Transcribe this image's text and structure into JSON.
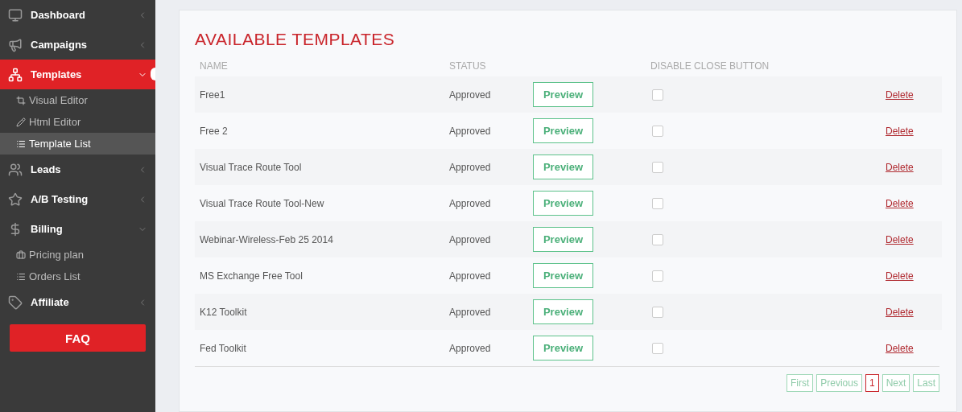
{
  "sidebar": {
    "items": [
      {
        "label": "Dashboard",
        "expanded": false,
        "selected": false
      },
      {
        "label": "Campaigns",
        "expanded": false,
        "selected": false
      },
      {
        "label": "Templates",
        "expanded": true,
        "selected": true,
        "children": [
          {
            "label": "Visual Editor",
            "selected": false
          },
          {
            "label": "Html Editor",
            "selected": false
          },
          {
            "label": "Template List",
            "selected": true
          }
        ]
      },
      {
        "label": "Leads",
        "expanded": false,
        "selected": false
      },
      {
        "label": "A/B Testing",
        "expanded": false,
        "selected": false
      },
      {
        "label": "Billing",
        "expanded": true,
        "selected": false,
        "children": [
          {
            "label": "Pricing plan",
            "selected": false
          },
          {
            "label": "Orders List",
            "selected": false
          }
        ]
      },
      {
        "label": "Affiliate",
        "expanded": false,
        "selected": false
      }
    ],
    "faq_button": "FAQ"
  },
  "panel": {
    "title": "AVAILABLE TEMPLATES",
    "table": {
      "columns": [
        "NAME",
        "STATUS",
        "DISABLE CLOSE BUTTON"
      ],
      "rows": [
        {
          "name": "Free1",
          "status": "Approved",
          "preview": "Preview",
          "checked": false,
          "delete": "Delete"
        },
        {
          "name": "Free 2",
          "status": "Approved",
          "preview": "Preview",
          "checked": false,
          "delete": "Delete"
        },
        {
          "name": "Visual Trace Route Tool",
          "status": "Approved",
          "preview": "Preview",
          "checked": false,
          "delete": "Delete"
        },
        {
          "name": "Visual Trace Route Tool-New",
          "status": "Approved",
          "preview": "Preview",
          "checked": false,
          "delete": "Delete"
        },
        {
          "name": "Webinar-Wireless-Feb 25 2014",
          "status": "Approved",
          "preview": "Preview",
          "checked": false,
          "delete": "Delete"
        },
        {
          "name": "MS Exchange Free Tool",
          "status": "Approved",
          "preview": "Preview",
          "checked": false,
          "delete": "Delete"
        },
        {
          "name": "K12 Toolkit",
          "status": "Approved",
          "preview": "Preview",
          "checked": false,
          "delete": "Delete"
        },
        {
          "name": "Fed Toolkit",
          "status": "Approved",
          "preview": "Preview",
          "checked": false,
          "delete": "Delete"
        }
      ]
    },
    "pagination": [
      {
        "label": "First",
        "selected": false
      },
      {
        "label": "Previous",
        "selected": false
      },
      {
        "label": "1",
        "selected": true
      },
      {
        "label": "Next",
        "selected": false
      },
      {
        "label": "Last",
        "selected": false
      }
    ]
  }
}
